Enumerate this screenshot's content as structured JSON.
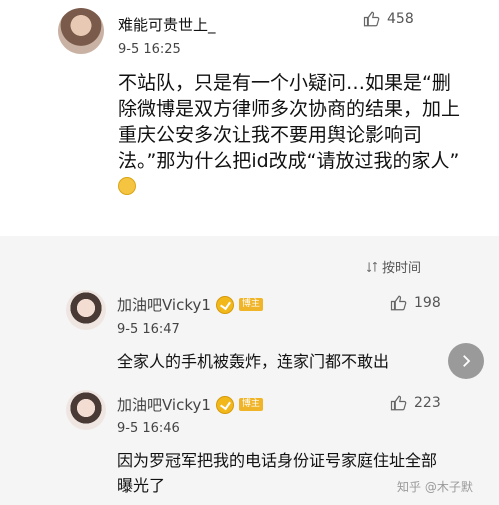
{
  "main_comment": {
    "username": "难能可贵世上_",
    "time": "9-5 16:25",
    "likes": "458",
    "text": "不站队，只是有一个小疑问…如果是“删除微博是双方律师多次协商的结果，加上重庆公安多次让我不要用舆论影响司法。”那为什么把id改成“请放过我的家人”"
  },
  "sort_label": "按时间",
  "replies": [
    {
      "username": "加油吧Vicky1",
      "badge": "博主",
      "time": "9-5 16:47",
      "likes": "198",
      "text": "全家人的手机被轰炸，连家门都不敢出"
    },
    {
      "username": "加油吧Vicky1",
      "badge": "博主",
      "time": "9-5 16:46",
      "likes": "223",
      "text": "因为罗冠军把我的电话身份证号家庭住址全部曝光了"
    }
  ],
  "watermark": "知乎 @木子默",
  "icons": {
    "like": "thumbs-up-icon",
    "sort": "sort-icon",
    "next": "chevron-right-icon",
    "emoji": "emoji-icon",
    "verified": "verified-icon"
  }
}
